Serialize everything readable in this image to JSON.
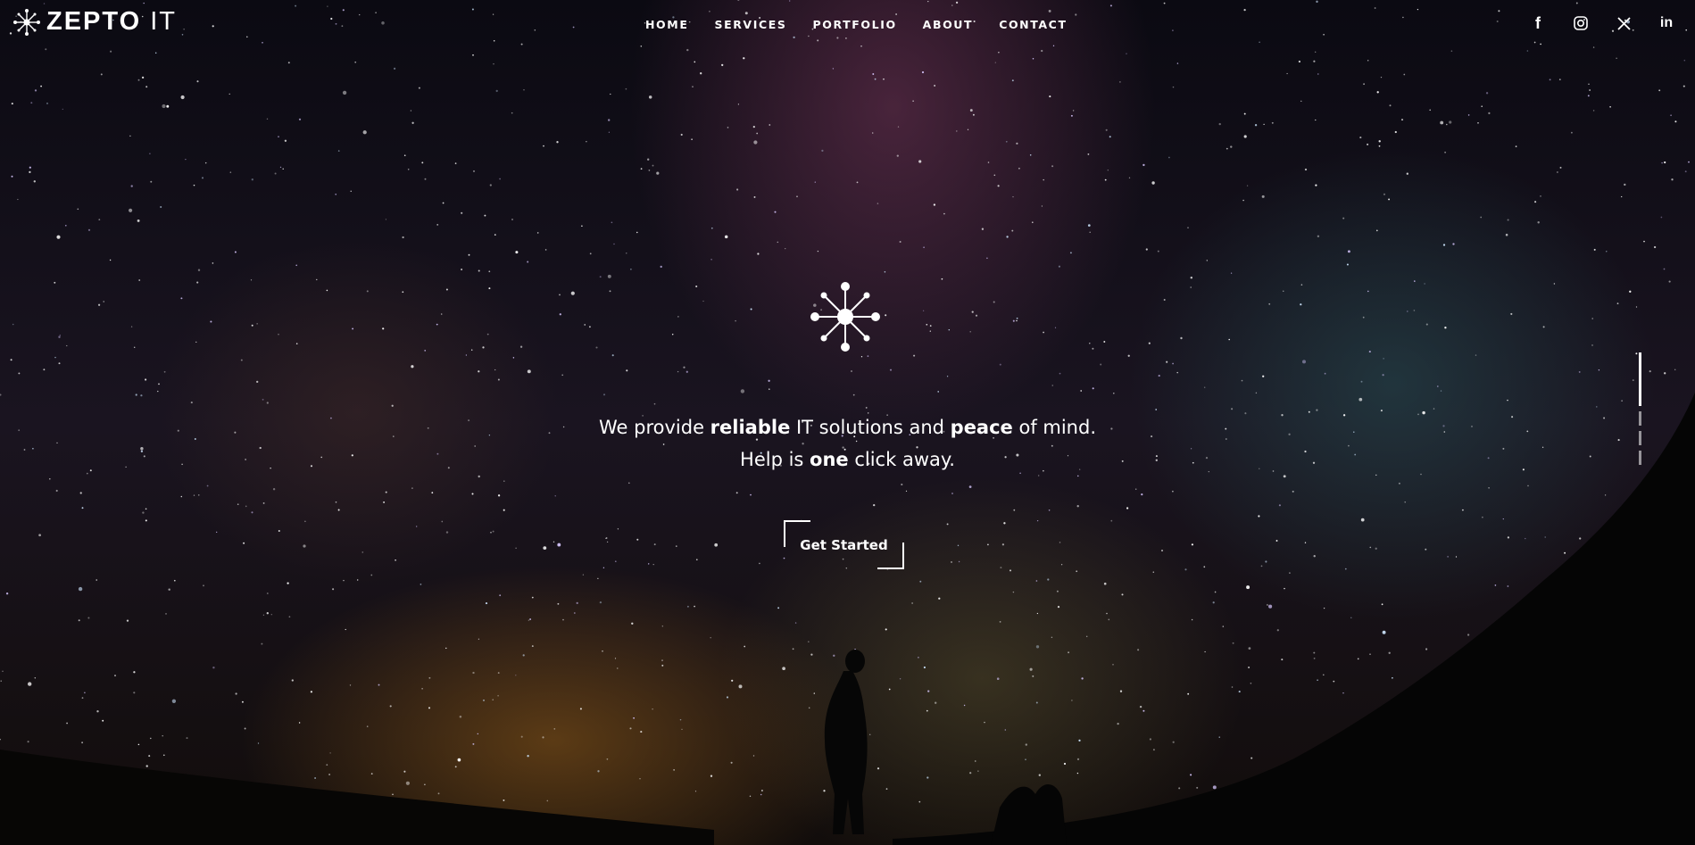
{
  "brand": {
    "name_bold": "ZEPTO",
    "name_light": "IT",
    "logo_icon": "network-hub-icon"
  },
  "nav": {
    "items": [
      {
        "label": "HOME"
      },
      {
        "label": "SERVICES"
      },
      {
        "label": "PORTFOLIO"
      },
      {
        "label": "ABOUT"
      },
      {
        "label": "CONTACT"
      }
    ]
  },
  "social": [
    {
      "icon": "facebook-icon",
      "glyph": "f"
    },
    {
      "icon": "instagram-icon"
    },
    {
      "icon": "x-twitter-icon"
    },
    {
      "icon": "linkedin-icon",
      "glyph": "in"
    }
  ],
  "hero": {
    "icon": "network-hub-icon",
    "line1": {
      "pre": "We provide ",
      "b1": "reliable",
      "mid": " IT solutions and ",
      "b2": "peace",
      "post": " of mind."
    },
    "line2": {
      "pre": "Help is ",
      "b1": "one",
      "post": " click away."
    },
    "cta_label": "Get Started"
  },
  "scroll_indicator": {
    "slides": 4,
    "active": 1
  },
  "colors": {
    "text": "#ffffff",
    "background": "#0b0a12"
  }
}
